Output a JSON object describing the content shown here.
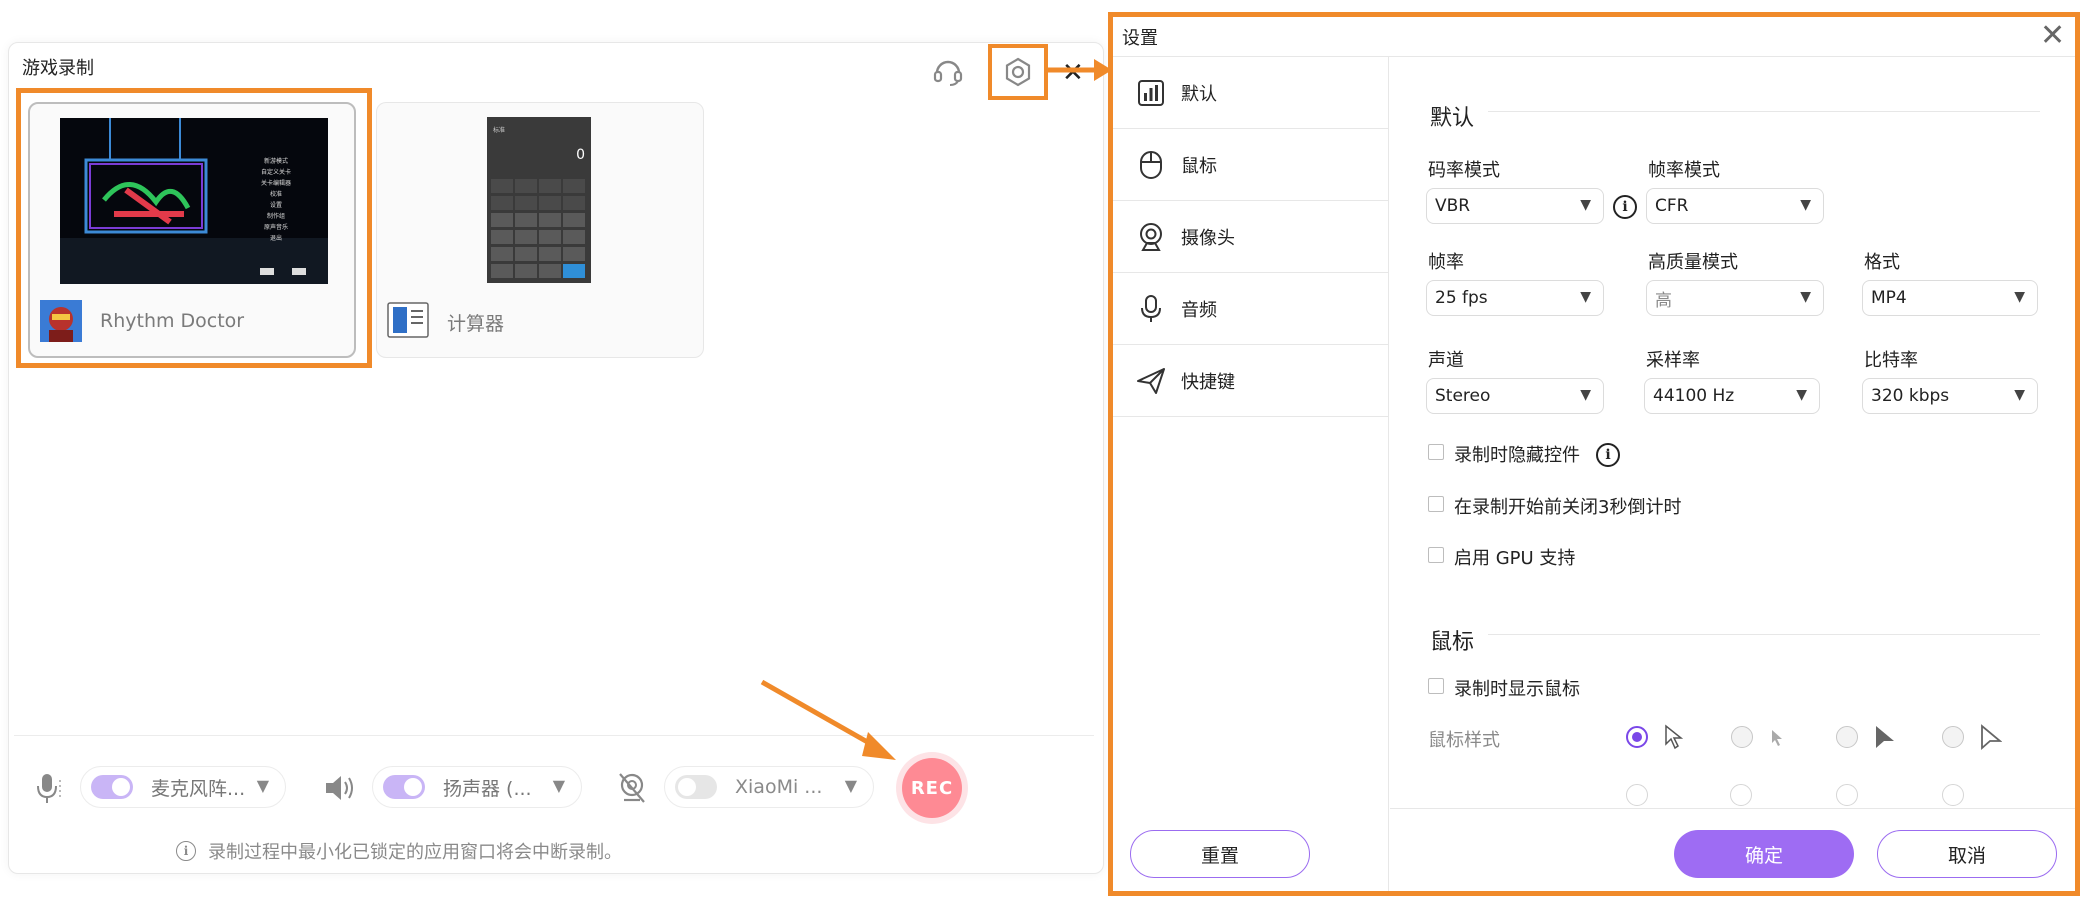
{
  "game_window": {
    "title": "游戏录制",
    "apps": [
      {
        "name": "Rhythm Doctor"
      },
      {
        "name": "计算器"
      }
    ],
    "controls": {
      "microphone": "麦克风阵...",
      "speaker": "扬声器 (...",
      "camera": "XiaoMi ..."
    },
    "rec_label": "REC",
    "info_text": "录制过程中最小化已锁定的应用窗口将会中断录制。",
    "rhythm_thumb_menu": [
      "新游模式",
      "自定义关卡",
      "关卡编辑器",
      "校准",
      "设置",
      "制作组",
      "原声音乐",
      "退出"
    ],
    "calc_thumb": {
      "mode": "标准",
      "display": "0"
    }
  },
  "settings": {
    "title": "设置",
    "nav": [
      {
        "label": "默认",
        "icon": "bar-chart-icon"
      },
      {
        "label": "鼠标",
        "icon": "mouse-icon"
      },
      {
        "label": "摄像头",
        "icon": "webcam-icon"
      },
      {
        "label": "音频",
        "icon": "microphone-icon"
      },
      {
        "label": "快捷键",
        "icon": "paper-plane-icon"
      }
    ],
    "reset_label": "重置",
    "default_section": {
      "title": "默认",
      "bitrate_mode": {
        "label": "码率模式",
        "value": "VBR"
      },
      "framerate_mode": {
        "label": "帧率模式",
        "value": "CFR"
      },
      "framerate": {
        "label": "帧率",
        "value": "25 fps"
      },
      "quality_mode": {
        "label": "高质量模式",
        "value": "高"
      },
      "format": {
        "label": "格式",
        "value": "MP4"
      },
      "channel": {
        "label": "声道",
        "value": "Stereo"
      },
      "sample_rate": {
        "label": "采样率",
        "value": "44100 Hz"
      },
      "bitrate": {
        "label": "比特率",
        "value": "320 kbps"
      },
      "hide_controls": "录制时隐藏控件",
      "close_countdown": "在录制开始前关闭3秒倒计时",
      "gpu_support": "启用 GPU 支持"
    },
    "mouse_section": {
      "title": "鼠标",
      "show_cursor": "录制时显示鼠标",
      "cursor_style_label": "鼠标样式"
    },
    "ok_label": "确定",
    "cancel_label": "取消"
  },
  "colors": {
    "highlight": "#f08a2a",
    "accent": "#9e6cf3",
    "rec": "#fe8a94"
  }
}
